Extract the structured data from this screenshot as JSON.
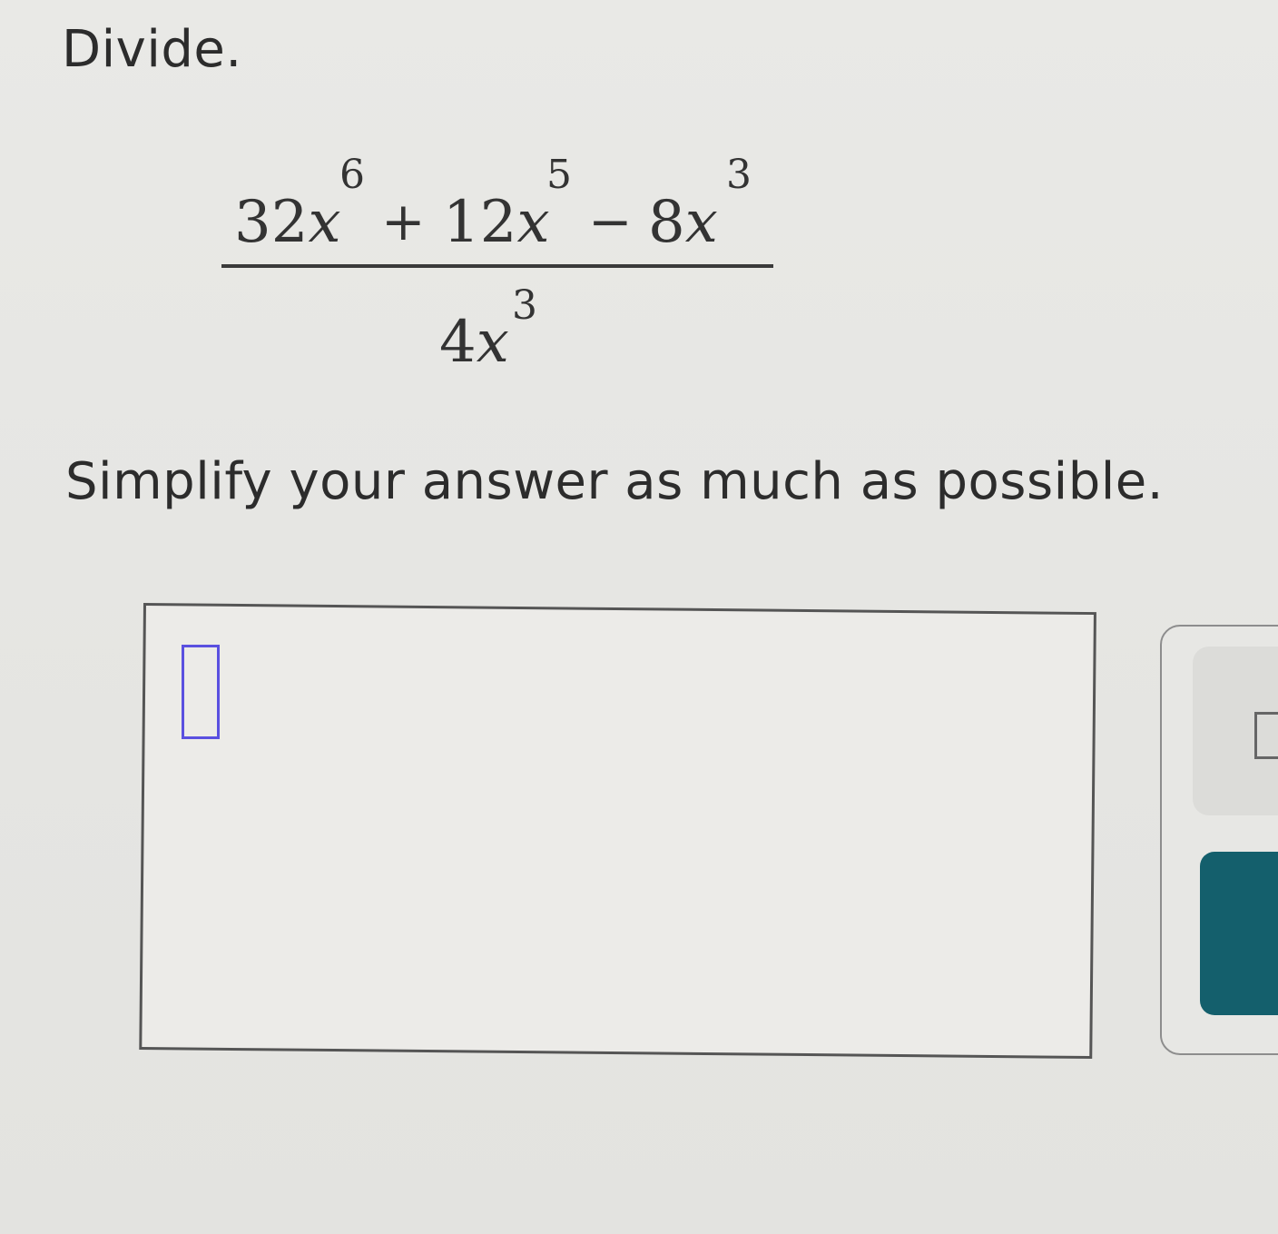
{
  "problem": {
    "instruction": "Divide.",
    "expression": {
      "numerator": {
        "term1": {
          "coef": "32",
          "var": "x",
          "exp": "6"
        },
        "op1": "+",
        "term2": {
          "coef": "12",
          "var": "x",
          "exp": "5"
        },
        "op2": "−",
        "term3": {
          "coef": "8",
          "var": "x",
          "exp": "3"
        }
      },
      "denominator": {
        "coef": "4",
        "var": "x",
        "exp": "3"
      }
    },
    "prompt": "Simplify your answer as much as possible."
  },
  "answer": {
    "value": ""
  },
  "colors": {
    "caret": "#5a50e0",
    "action_button": "#145f6c"
  },
  "icons": {
    "template": "exponent-template-icon"
  }
}
